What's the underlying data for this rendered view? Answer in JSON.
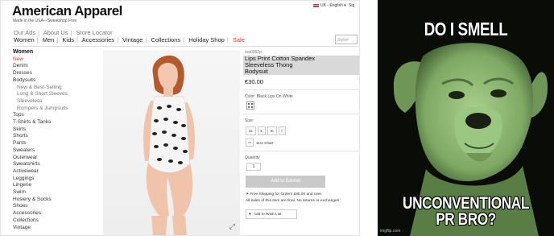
{
  "store": {
    "brand": "American Apparel",
    "brand_sub": "Made in the USA—Sweatshop Free",
    "locale": "UK - English ▾",
    "signin": "Sig",
    "util_links": [
      "Our Ads",
      "About Us",
      "Store Locator"
    ],
    "nav": [
      "Women",
      "Men",
      "Kids",
      "Accessories",
      "Vintage",
      "Collections",
      "Holiday Shop",
      "Sale"
    ],
    "search_placeholder": "Style#",
    "categories": [
      {
        "label": "Women",
        "kind": "title"
      },
      {
        "label": "New",
        "kind": "new"
      },
      {
        "label": "Denim",
        "kind": "item"
      },
      {
        "label": "Dresses",
        "kind": "item"
      },
      {
        "label": "Bodysuits",
        "kind": "item"
      },
      {
        "label": "New & Best-Selling",
        "kind": "sub"
      },
      {
        "label": "Long & Short Sleeves",
        "kind": "sub"
      },
      {
        "label": "Sleeveless",
        "kind": "sub"
      },
      {
        "label": "Rompers & Jumpsuits",
        "kind": "sub"
      },
      {
        "label": "Tops",
        "kind": "item"
      },
      {
        "label": "T-Shirts & Tanks",
        "kind": "item"
      },
      {
        "label": "Skirts",
        "kind": "item"
      },
      {
        "label": "Shorts",
        "kind": "item"
      },
      {
        "label": "Pants",
        "kind": "item"
      },
      {
        "label": "Sweaters",
        "kind": "item"
      },
      {
        "label": "Outerwear",
        "kind": "item"
      },
      {
        "label": "Sweatshirts",
        "kind": "item"
      },
      {
        "label": "Activewear",
        "kind": "item"
      },
      {
        "label": "Leggings",
        "kind": "item"
      },
      {
        "label": "Lingerie",
        "kind": "item"
      },
      {
        "label": "Swim",
        "kind": "item"
      },
      {
        "label": "Hosiery & Socks",
        "kind": "item"
      },
      {
        "label": "Shoes",
        "kind": "item"
      },
      {
        "label": "Accessories",
        "kind": "item"
      },
      {
        "label": "Collections",
        "kind": "item"
      },
      {
        "label": "Vintage",
        "kind": "item"
      }
    ],
    "product": {
      "sku": "rsa0362p",
      "title_lines": [
        "Lips Print Cotton Spandex",
        "Sleeveless Thong",
        "Bodysuit"
      ],
      "price": "€30.00",
      "color_label": "Color: Black Lips On White",
      "size_label": "Size:",
      "sizes": [
        "xs",
        "s",
        "m",
        "l"
      ],
      "size_chart": "Size Chart",
      "quantity_label": "Quantity",
      "quantity": "1",
      "basket_button": "Add to Basket",
      "shipping_note": "✈ Free Shipping for Orders £85.00 and over.",
      "final_sale_note": "All sales of this item are final. No returns or exchanges",
      "wishlist_button": "Add to Wish List"
    }
  },
  "meme": {
    "top_text": "DO I SMELL",
    "bottom_line1": "UNCONVENTIONAL",
    "bottom_line2": "PR BRO?",
    "watermark": "imgflip.com"
  },
  "colors": {
    "sale_red": "#e33333",
    "title_highlight": "#d9d9d9",
    "basket_button": "#c9c9c9",
    "meme_bg": "#0a0c08",
    "dog_green": "#8fbf74"
  },
  "icons": [
    "zoom-expand-icon",
    "size-chart-icon",
    "heart-icon",
    "plane-icon"
  ]
}
